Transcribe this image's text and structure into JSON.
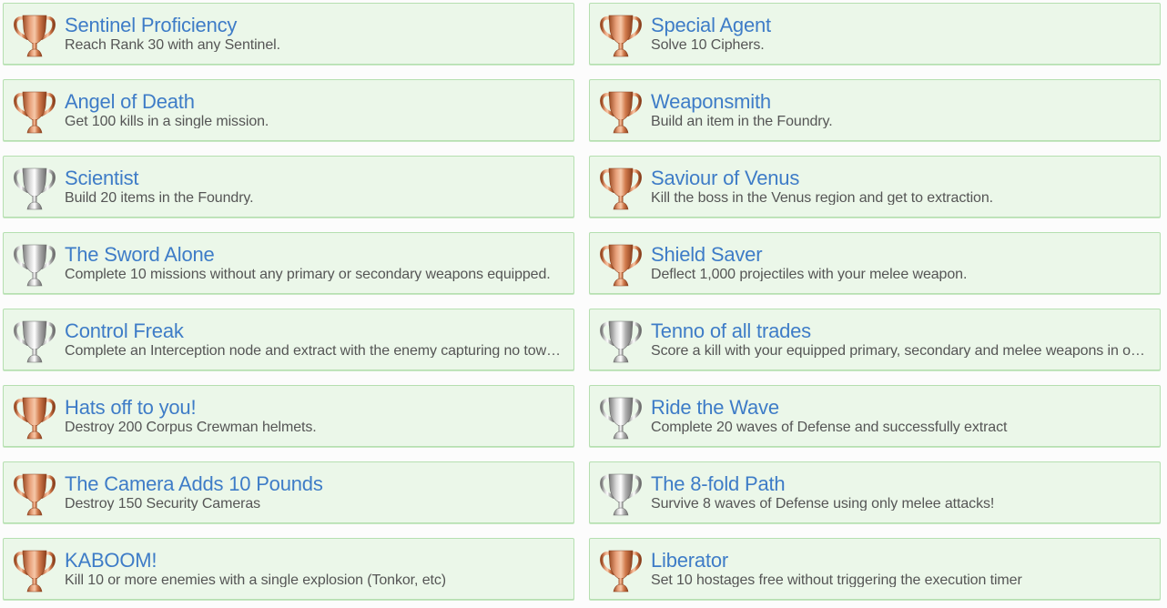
{
  "colors": {
    "title": "#3e7cc7",
    "description": "#555555",
    "card_background": "#ebf7e9",
    "card_border": "#b5dfb0",
    "bronze": "#c8703e",
    "silver": "#a8a8a8"
  },
  "achievements": [
    {
      "title": "Sentinel Proficiency",
      "description": "Reach Rank 30 with any Sentinel.",
      "trophy": "bronze"
    },
    {
      "title": "Special Agent",
      "description": "Solve 10 Ciphers.",
      "trophy": "bronze"
    },
    {
      "title": "Angel of Death",
      "description": "Get 100 kills in a single mission.",
      "trophy": "bronze"
    },
    {
      "title": "Weaponsmith",
      "description": "Build an item in the Foundry.",
      "trophy": "bronze"
    },
    {
      "title": "Scientist",
      "description": "Build 20 items in the Foundry.",
      "trophy": "silver"
    },
    {
      "title": "Saviour of Venus",
      "description": "Kill the boss in the Venus region and get to extraction.",
      "trophy": "bronze"
    },
    {
      "title": "The Sword Alone",
      "description": "Complete 10 missions without any primary or secondary weapons equipped.",
      "trophy": "silver"
    },
    {
      "title": "Shield Saver",
      "description": "Deflect 1,000 projectiles with your melee weapon.",
      "trophy": "bronze"
    },
    {
      "title": "Control Freak",
      "description": "Complete an Interception node and extract with the enemy capturing no towers.",
      "trophy": "silver"
    },
    {
      "title": "Tenno of all trades",
      "description": "Score a kill with your equipped primary, secondary and melee weapons in one mission.",
      "trophy": "silver"
    },
    {
      "title": "Hats off to you!",
      "description": "Destroy 200 Corpus Crewman helmets.",
      "trophy": "bronze"
    },
    {
      "title": "Ride the Wave",
      "description": "Complete 20 waves of Defense and successfully extract",
      "trophy": "silver"
    },
    {
      "title": "The Camera Adds 10 Pounds",
      "description": "Destroy 150 Security Cameras",
      "trophy": "bronze"
    },
    {
      "title": "The 8-fold Path",
      "description": "Survive 8 waves of Defense using only melee attacks!",
      "trophy": "silver"
    },
    {
      "title": "KABOOM!",
      "description": "Kill 10 or more enemies with a single explosion (Tonkor, etc)",
      "trophy": "bronze"
    },
    {
      "title": "Liberator",
      "description": "Set 10 hostages free without triggering the execution timer",
      "trophy": "bronze"
    }
  ]
}
